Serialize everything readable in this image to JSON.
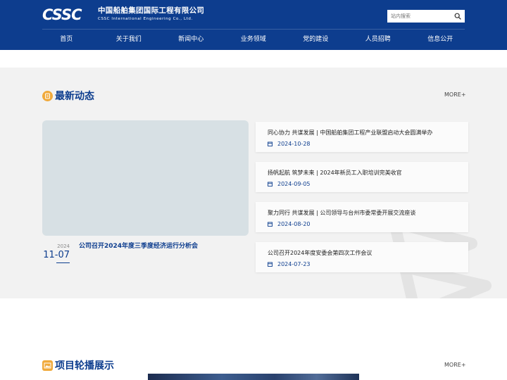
{
  "header": {
    "logo_mark": "CSSC",
    "logo_cn": "中国船舶集团国际工程有限公司",
    "logo_en": "CSSC International Engineering Co., Ltd.",
    "search_placeholder": "站内搜索",
    "bg_color": "#0d3d8e"
  },
  "nav": [
    "首页",
    "关于我们",
    "新闻中心",
    "业务领域",
    "党的建设",
    "人员招聘",
    "信息公开"
  ],
  "news": {
    "title": "最新动态",
    "more": "MORE+",
    "feature": {
      "year": "2024",
      "month_day": "11-07",
      "title": "公司召开2024年度三季度经济运行分析会"
    },
    "items": [
      {
        "title": "同心协力 共谋发展 | 中国船舶集团工程产业联盟启动大会圆满举办",
        "date": "2024-10-28"
      },
      {
        "title": "扬帆起航 筑梦未来 | 2024年新员工入职培训完美收官",
        "date": "2024-09-05"
      },
      {
        "title": "聚力同行 共谋发展 | 公司领导与台州市委常委开展交流座谈",
        "date": "2024-08-20"
      },
      {
        "title": "公司召开2024年度安委会第四次工作会议",
        "date": "2024-07-23"
      }
    ]
  },
  "gallery": {
    "title": "项目轮播展示",
    "more": "MORE+"
  },
  "icons": {
    "news_icon": "news-icon",
    "gallery_icon": "image-gallery-icon",
    "search_icon": "search-icon",
    "calendar_icon": "calendar-icon"
  },
  "colors": {
    "primary": "#0d3d8e",
    "accent": "#f0a93b",
    "section_bg": "#f2f2f2"
  }
}
